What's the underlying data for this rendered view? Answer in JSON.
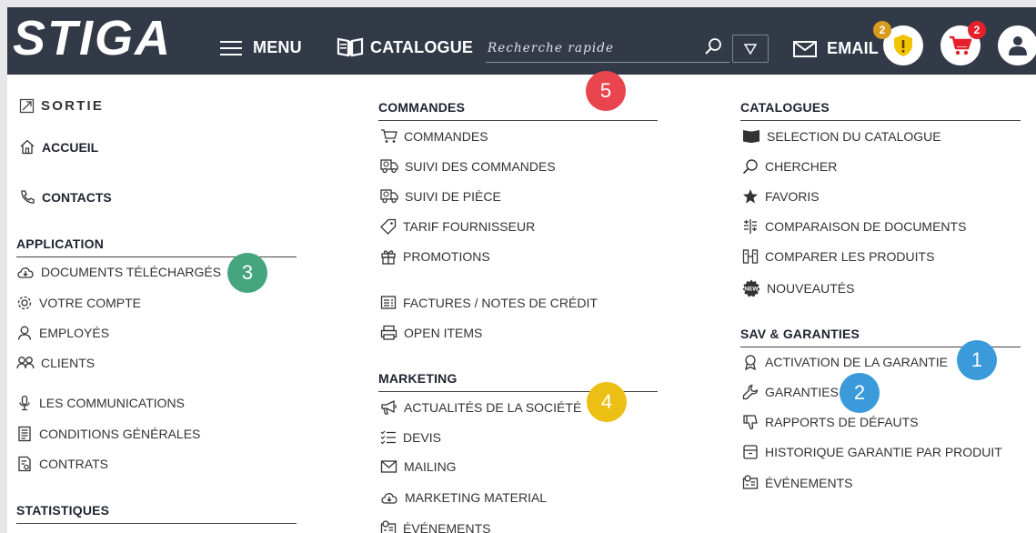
{
  "header": {
    "brand": "STIGA",
    "menu_label": "MENU",
    "catalogue_label": "CATALOGUE",
    "search_placeholder": "Recherche rapide",
    "email_label": "EMAIL",
    "alerts_badge": "2",
    "cart_badge": "2",
    "colors": {
      "bar": "#323a48",
      "alert": "#f2c400",
      "cart": "#e5202a",
      "alert_badge": "#d69b1f"
    }
  },
  "left": {
    "exit": "SORTIE",
    "home": "ACCUEIL",
    "contacts": "CONTACTS",
    "application_heading": "APPLICATION",
    "application_items": [
      "DOCUMENTS TÉLÉCHARGÉS",
      "VOTRE COMPTE",
      "EMPLOYÉS",
      "CLIENTS",
      "LES COMMUNICATIONS",
      "CONDITIONS GÉNÉRALES",
      "CONTRATS"
    ],
    "statistics_heading": "STATISTIQUES"
  },
  "middle": {
    "orders_heading": "COMMANDES",
    "orders_items": [
      "COMMANDES",
      "SUIVI DES COMMANDES",
      "SUIVI DE PIÈCE",
      "TARIF FOURNISSEUR",
      "PROMOTIONS",
      "FACTURES / NOTES DE CRÉDIT",
      "OPEN ITEMS"
    ],
    "marketing_heading": "MARKETING",
    "marketing_items": [
      "ACTUALITÉS DE LA SOCIÉTÉ",
      "DEVIS",
      "MAILING",
      "MARKETING MATERIAL",
      "ÉVÉNEMENTS"
    ]
  },
  "right": {
    "catalogues_heading": "CATALOGUES",
    "catalogues_items": [
      "SELECTION DU CATALOGUE",
      "CHERCHER",
      "FAVORIS",
      "COMPARAISON DE DOCUMENTS",
      "COMPARER LES PRODUITS",
      "NOUVEAUTÉS"
    ],
    "sav_heading": "SAV & GARANTIES",
    "sav_items": [
      "ACTIVATION DE LA GARANTIE",
      "GARANTIES",
      "RAPPORTS DE DÉFAUTS",
      "HISTORIQUE GARANTIE PAR PRODUIT",
      "ÉVÉNEMENTS"
    ],
    "new_icon_text": "NEW"
  },
  "markers": {
    "m1": "1",
    "m2": "2",
    "m3": "3",
    "m4": "4",
    "m5": "5",
    "colors": {
      "blue": "#3b9ad9",
      "green": "#45a57e",
      "yellow": "#ecbf15",
      "red": "#e8454f"
    }
  }
}
